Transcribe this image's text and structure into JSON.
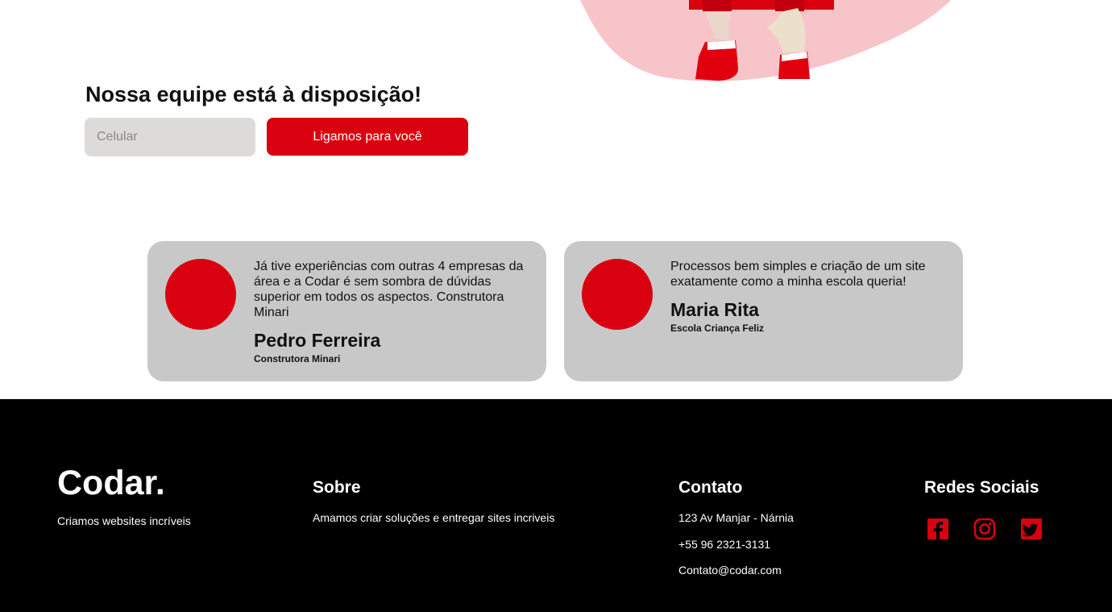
{
  "cta": {
    "title": "Nossa equipe está à disposição!",
    "phone_placeholder": "Celular",
    "button_label": "Ligamos para você"
  },
  "testimonials": [
    {
      "quote": "Já tive experiências com outras 4 empresas da área e a Codar é sem sombra de dúvidas superior em todos os aspectos. Construtora Minari",
      "name": "Pedro Ferreira",
      "company": "Construtora Minari"
    },
    {
      "quote": "Processos bem simples e criação de um site exatamente como a minha escola queria!",
      "name": "Maria Rita",
      "company": "Escola Criança Feliz"
    }
  ],
  "footer": {
    "brand": "Codar.",
    "tagline": "Criamos websites incríveis",
    "about": {
      "title": "Sobre",
      "text": "Amamos criar soluções e entregar sites incriveis"
    },
    "contact": {
      "title": "Contato",
      "address": "123 Av Manjar - Nárnia",
      "phone": "+55 96 2321-3131",
      "email": "Contato@codar.com"
    },
    "social": {
      "title": "Redes Sociais",
      "icons": [
        "facebook-icon",
        "instagram-icon",
        "twitter-icon"
      ]
    }
  },
  "colors": {
    "accent": "#d9000f",
    "card_bg": "#c8c8c8",
    "input_bg": "#dcdbd9",
    "footer_bg": "#000000"
  }
}
